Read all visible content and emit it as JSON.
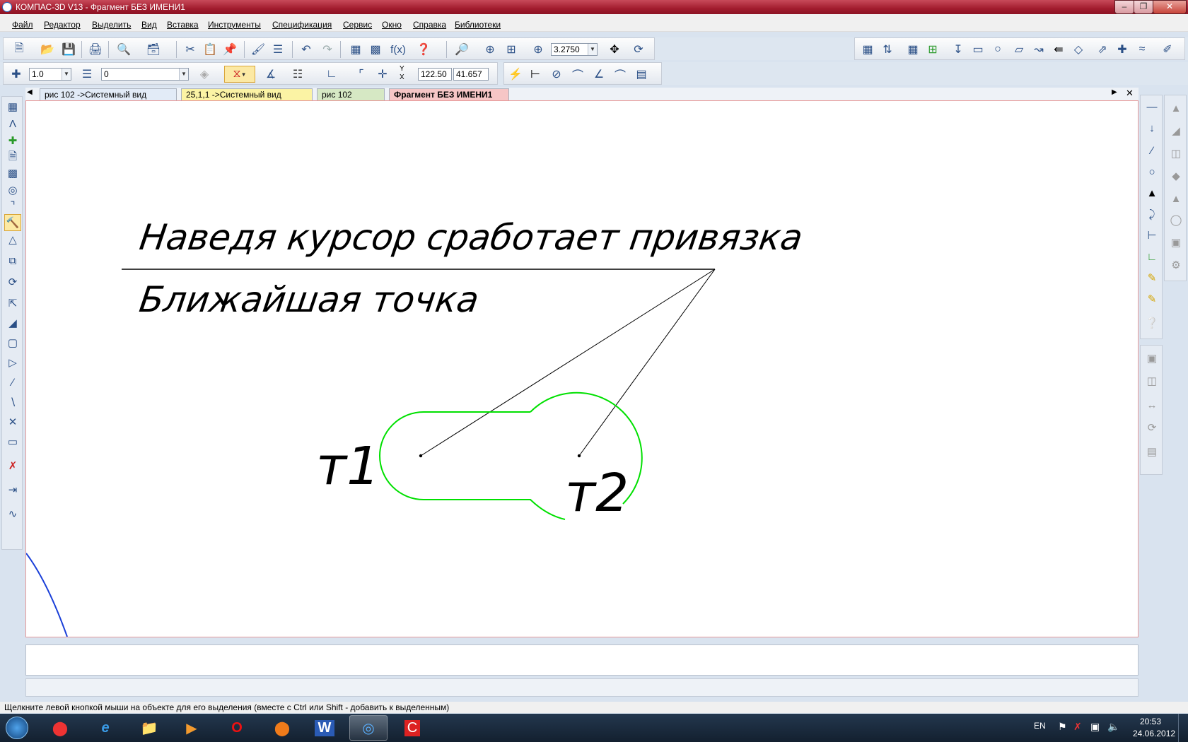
{
  "window": {
    "title": "КОМПАС-3D V13 - Фрагмент БЕЗ ИМЕНИ1",
    "min_icon": "minimize-icon",
    "max_icon": "restore-icon",
    "close_icon": "close-icon"
  },
  "menu": [
    {
      "label": "Файл"
    },
    {
      "label": "Редактор"
    },
    {
      "label": "Выделить"
    },
    {
      "label": "Вид"
    },
    {
      "label": "Вставка"
    },
    {
      "label": "Инструменты"
    },
    {
      "label": "Спецификация"
    },
    {
      "label": "Сервис"
    },
    {
      "label": "Окно"
    },
    {
      "label": "Справка"
    },
    {
      "label": "Библиотеки"
    }
  ],
  "toolbar": {
    "zoom_value": "3.2750",
    "step_value": "1.0",
    "layer_value": "0",
    "coord_y_label": "Y",
    "coord_x_label": "X",
    "coord_x_value": "122.50",
    "coord_y_value": "41.657"
  },
  "tabs": [
    {
      "label": "рис 102 ->Системный вид"
    },
    {
      "label": "25,1,1 ->Системный вид"
    },
    {
      "label": "рис 102"
    },
    {
      "label": "Фрагмент БЕЗ ИМЕНИ1"
    }
  ],
  "drawing": {
    "leader_text_1": "Наведя курсор сработает привязка",
    "leader_text_2": "Ближайшая точка",
    "point_label_1": "т1",
    "point_label_2": "т2",
    "shape_color": "#00e000"
  },
  "status": {
    "hint": "Щелкните левой кнопкой мыши на объекте для его выделения (вместе с Ctrl или Shift - добавить к выделенным)"
  },
  "taskbar": {
    "lang": "EN",
    "time": "20:53",
    "date": "24.06.2012"
  }
}
